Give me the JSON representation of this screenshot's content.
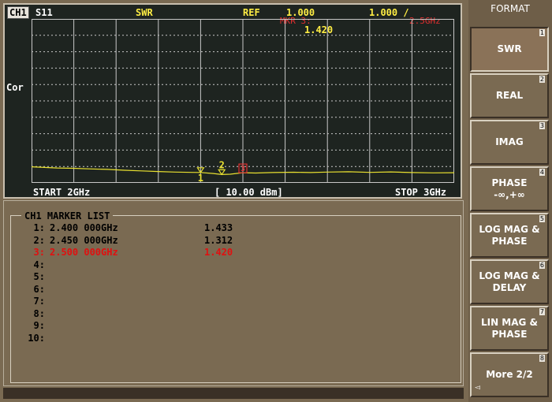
{
  "trace": {
    "channel": "CH1",
    "parameter": "S11",
    "format": "SWR",
    "ref_label": "REF",
    "ref_value": "1.000",
    "scale": "1.000 /",
    "marker_label": "MKR 3:",
    "marker_value": "1.420",
    "marker_freq": "2.5GHz",
    "correction": "Cor",
    "start": "START 2GHz",
    "power": "[ 10.00 dBm]",
    "stop": "STOP 3GHz",
    "trace_color": "#e8e030",
    "marker_colors": {
      "normal": "#e8e030",
      "active": "#e03030"
    }
  },
  "trace_data": {
    "x_start_ghz": 2.0,
    "x_stop_ghz": 3.0,
    "y_ref": 1.0,
    "y_per_div": 1.0,
    "points": [
      [
        2.0,
        1.78
      ],
      [
        2.03,
        1.74
      ],
      [
        2.06,
        1.71
      ],
      [
        2.1,
        1.69
      ],
      [
        2.14,
        1.65
      ],
      [
        2.18,
        1.62
      ],
      [
        2.22,
        1.57
      ],
      [
        2.26,
        1.53
      ],
      [
        2.3,
        1.49
      ],
      [
        2.34,
        1.46
      ],
      [
        2.38,
        1.44
      ],
      [
        2.4,
        1.433
      ],
      [
        2.43,
        1.37
      ],
      [
        2.45,
        1.312
      ],
      [
        2.47,
        1.33
      ],
      [
        2.5,
        1.42
      ],
      [
        2.53,
        1.4
      ],
      [
        2.57,
        1.43
      ],
      [
        2.62,
        1.45
      ],
      [
        2.66,
        1.43
      ],
      [
        2.7,
        1.46
      ],
      [
        2.75,
        1.48
      ],
      [
        2.8,
        1.44
      ],
      [
        2.85,
        1.47
      ],
      [
        2.9,
        1.43
      ],
      [
        2.95,
        1.41
      ],
      [
        3.0,
        1.42
      ]
    ],
    "markers": [
      {
        "id": "1",
        "freq": 2.4,
        "value": 1.433,
        "active": false
      },
      {
        "id": "2",
        "freq": 2.45,
        "value": 1.312,
        "active": false
      },
      {
        "id": "3",
        "freq": 2.5,
        "value": 1.42,
        "active": true
      }
    ]
  },
  "marker_list": {
    "title": "CH1 MARKER LIST",
    "rows": [
      {
        "num": "1:",
        "freq": "2.400 000GHz",
        "value": "1.433"
      },
      {
        "num": "2:",
        "freq": "2.450 000GHz",
        "value": "1.312"
      },
      {
        "num": "3:",
        "freq": "2.500 000GHz",
        "value": "1.420"
      },
      {
        "num": "4:",
        "freq": "",
        "value": ""
      },
      {
        "num": "5:",
        "freq": "",
        "value": ""
      },
      {
        "num": "6:",
        "freq": "",
        "value": ""
      },
      {
        "num": "7:",
        "freq": "",
        "value": ""
      },
      {
        "num": "8:",
        "freq": "",
        "value": ""
      },
      {
        "num": "9:",
        "freq": "",
        "value": ""
      },
      {
        "num": "10:",
        "freq": "",
        "value": ""
      }
    ],
    "active_index": 2
  },
  "softkeys": {
    "title": "FORMAT",
    "items": [
      {
        "line1": "SWR",
        "line2": "",
        "index": "1",
        "selected": true
      },
      {
        "line1": "REAL",
        "line2": "",
        "index": "2",
        "selected": false
      },
      {
        "line1": "IMAG",
        "line2": "",
        "index": "3",
        "selected": false
      },
      {
        "line1": "PHASE",
        "line2": "-∞,+∞",
        "index": "4",
        "selected": false
      },
      {
        "line1": "LOG MAG &",
        "line2": "PHASE",
        "index": "5",
        "selected": false
      },
      {
        "line1": "LOG MAG &",
        "line2": "DELAY",
        "index": "6",
        "selected": false
      },
      {
        "line1": "LIN MAG &",
        "line2": "PHASE",
        "index": "7",
        "selected": false
      },
      {
        "line1": "More 2/2",
        "line2": "",
        "index": "8",
        "selected": false
      }
    ]
  }
}
